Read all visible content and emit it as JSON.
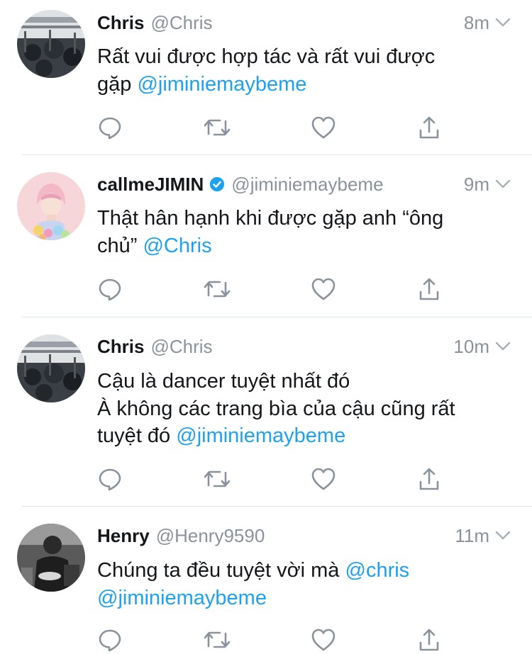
{
  "colors": {
    "link": "#1da1f2",
    "muted": "#8a939b",
    "divider": "#e1e8ed",
    "verified": "#1da1f2"
  },
  "tweets": [
    {
      "name": "Chris",
      "handle": "@Chris",
      "verified": false,
      "time": "8m",
      "avatar": "building-photo",
      "lines": [
        {
          "text": "Rất vui được hợp tác và rất vui được",
          "mention": ""
        },
        {
          "text": "gặp ",
          "mention": "@jiminiemaybeme"
        }
      ]
    },
    {
      "name": "callmeJIMIN",
      "handle": "@jiminiemaybeme",
      "verified": true,
      "time": "9m",
      "avatar": "portrait-with-flowers",
      "lines": [
        {
          "text": "Thật hân hạnh khi được gặp anh “ông",
          "mention": ""
        },
        {
          "text": "chủ” ",
          "mention": "@Chris"
        }
      ]
    },
    {
      "name": "Chris",
      "handle": "@Chris",
      "verified": false,
      "time": "10m",
      "avatar": "building-photo",
      "lines": [
        {
          "text": "Cậu là dancer tuyệt nhất đó",
          "mention": ""
        },
        {
          "text": "À không các trang bìa của cậu cũng rất",
          "mention": ""
        },
        {
          "text": "tuyệt đó ",
          "mention": "@jiminiemaybeme"
        }
      ]
    },
    {
      "name": "Henry",
      "handle": "@Henry9590",
      "verified": false,
      "time": "11m",
      "avatar": "bw-seated-person",
      "lines": [
        {
          "text": "Chúng ta đều tuyệt vời mà ",
          "mention": "@chris"
        },
        {
          "text": "",
          "mention": "@jiminiemaybeme"
        }
      ]
    }
  ],
  "action_icons": [
    "reply-icon",
    "retweet-icon",
    "like-icon",
    "share-icon"
  ]
}
